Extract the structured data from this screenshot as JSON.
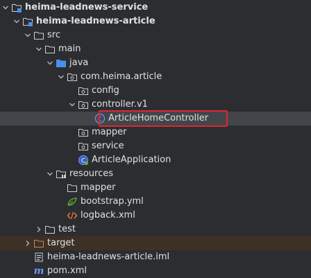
{
  "tree": {
    "rows": [
      {
        "label": "heima-leadnews-service",
        "icon": "module-folder-icon",
        "expanded": true
      },
      {
        "label": "heima-leadnews-article",
        "icon": "module-folder-icon",
        "expanded": true
      },
      {
        "label": "src",
        "icon": "folder-icon",
        "expanded": true
      },
      {
        "label": "main",
        "icon": "folder-icon",
        "expanded": true
      },
      {
        "label": "java",
        "icon": "source-folder-icon",
        "expanded": true
      },
      {
        "label": "com.heima.article",
        "icon": "package-icon",
        "expanded": true
      },
      {
        "label": "config",
        "icon": "package-icon",
        "expanded": false
      },
      {
        "label": "controller.v1",
        "icon": "package-icon",
        "expanded": true
      },
      {
        "label": "ArticleHomeController",
        "icon": "class-icon",
        "selected": true
      },
      {
        "label": "mapper",
        "icon": "package-icon",
        "expanded": false
      },
      {
        "label": "service",
        "icon": "package-icon",
        "expanded": false
      },
      {
        "label": "ArticleApplication",
        "icon": "spring-app-class-icon"
      },
      {
        "label": "resources",
        "icon": "resources-folder-icon",
        "expanded": true
      },
      {
        "label": "mapper",
        "icon": "folder-icon"
      },
      {
        "label": "bootstrap.yml",
        "icon": "yaml-file-icon"
      },
      {
        "label": "logback.xml",
        "icon": "xml-file-icon"
      },
      {
        "label": "test",
        "icon": "folder-icon",
        "expanded": false
      },
      {
        "label": "target",
        "icon": "excluded-folder-icon",
        "expanded": false,
        "excluded": true
      },
      {
        "label": "heima-leadnews-article.iml",
        "icon": "iml-file-icon"
      },
      {
        "label": "pom.xml",
        "icon": "maven-icon"
      }
    ]
  },
  "colors": {
    "background": "#2b2d30",
    "text": "#dfe1e5",
    "selection": "#43454a",
    "excluded_row": "#3d3024",
    "highlight_border": "#e0262e",
    "source_folder": "#4b8ef1",
    "class_icon": "#6b9bf5"
  }
}
